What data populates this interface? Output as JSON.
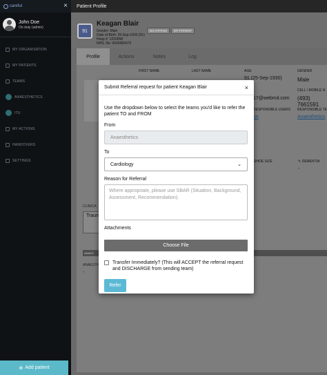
{
  "sidebar": {
    "logo_text": "careful",
    "user": {
      "name": "John Doe",
      "status": "On duty (admin)"
    },
    "items": [
      {
        "label": "MY ORGANISATION"
      },
      {
        "label": "MY PATIENTS"
      },
      {
        "label": "TEAMS"
      },
      {
        "label": "ANAESTHETICS"
      },
      {
        "label": "ITU"
      },
      {
        "label": "MY ACTIONS"
      },
      {
        "label": "HANDOVERS"
      },
      {
        "label": "SETTINGS"
      }
    ],
    "add_patient_label": "Add patient"
  },
  "topbar": {
    "title": "Patient Profile"
  },
  "patient": {
    "age_badge": "91",
    "name": "Keagan Blair",
    "gender_line": "Gender: Male",
    "dob_line": "Date of Birth: 25-Sep-1930 (91)",
    "hosp_line": "Hosp #: 1220658",
    "nhs_line": "NHS. No: 9426465472",
    "chips": [
      "NO STATUS",
      "MY PATIENT"
    ]
  },
  "tabs": [
    {
      "label": "Profile",
      "active": true
    },
    {
      "label": "Actions"
    },
    {
      "label": "Notes"
    },
    {
      "label": "Log"
    }
  ],
  "profile": {
    "headers": {
      "first_name": "FIRST NAME",
      "last_name": "LAST NAME",
      "age": "AGE",
      "gender": "GENDER"
    },
    "gender_value": "Male",
    "phone_header": "CELL / MOBILE N",
    "phone_value": "(493) 7661591",
    "responsible_header": "RESPONSIBLE USERS",
    "responsible_value": "on",
    "responsible_team_header": "RESPONSIBLE TE",
    "responsible_team_value": "Anaesthetics",
    "email_partial": "17@webmd.com",
    "age_partial": "91 (25-Sep-1930)",
    "shoe_size_label": "SHOE SIZE",
    "dementia_label": "DEMENTIA",
    "dementia_value": "-",
    "clinical_label": "CLINICA",
    "trauma_label": "Traum",
    "anaes_bar_label": "ANAES",
    "anaes_label": "ANAESTH",
    "anaes_value": "-"
  },
  "modal": {
    "title": "Submit Referral request for patient Keagan Blair",
    "close_label": "×",
    "instructions": "Use the dropdown below to select the teams you'd like to refer the patient TO and FROM",
    "from_label": "From",
    "from_value": "Anaesthetics",
    "to_label": "To",
    "to_value": "Cardiology",
    "reason_label": "Reason for Referral",
    "reason_placeholder": "Where appropriate, please use SBAR (Situation, Background, Assessment, Recommendation).",
    "attachments_label": "Attachments",
    "choose_file_label": "Choose File",
    "transfer_text": "Transfer Immediately? (This will ACCEPT the referral request and DISCHARGE from sending team)",
    "refer_label": "Refer"
  },
  "colors": {
    "accent": "#5cb9c9",
    "sidebar_bg": "#0f1215",
    "patient_icon_bg": "#4a5a8a"
  }
}
